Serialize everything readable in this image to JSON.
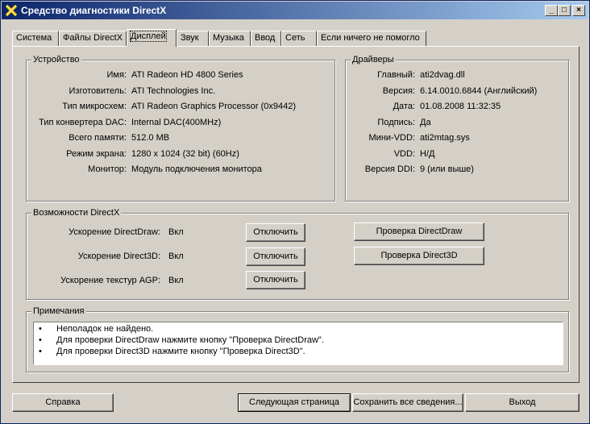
{
  "window": {
    "title": "Средство диагностики DirectX",
    "controls": {
      "minimize": "_",
      "maximize": "□",
      "close": "×"
    }
  },
  "tabs": [
    {
      "label": "Система"
    },
    {
      "label": "Файлы DirectX"
    },
    {
      "label": "Дисплей"
    },
    {
      "label": "Звук"
    },
    {
      "label": "Музыка"
    },
    {
      "label": "Ввод"
    },
    {
      "label": "Сеть"
    },
    {
      "label": "Если ничего не помогло"
    }
  ],
  "device": {
    "legend": "Устройство",
    "rows": [
      {
        "label": "Имя:",
        "value": "ATI Radeon HD 4800 Series"
      },
      {
        "label": "Изготовитель:",
        "value": "ATI Technologies Inc."
      },
      {
        "label": "Тип микросхем:",
        "value": "ATI Radeon Graphics Processor (0x9442)"
      },
      {
        "label": "Тип конвертера DAC:",
        "value": "Internal DAC(400MHz)"
      },
      {
        "label": "Всего памяти:",
        "value": "512.0 MB"
      },
      {
        "label": "Режим экрана:",
        "value": "1280 x 1024 (32 bit) (60Hz)"
      },
      {
        "label": "Монитор:",
        "value": "Модуль подключения монитора"
      }
    ]
  },
  "drivers": {
    "legend": "Драйверы",
    "rows": [
      {
        "label": "Главный:",
        "value": "ati2dvag.dll"
      },
      {
        "label": "Версия:",
        "value": "6.14.0010.6844 (Английский)"
      },
      {
        "label": "Дата:",
        "value": "01.08.2008 11:32:35"
      },
      {
        "label": "Подпись:",
        "value": "Да"
      },
      {
        "label": "Мини-VDD:",
        "value": "ati2mtag.sys"
      },
      {
        "label": "VDD:",
        "value": "Н/Д"
      },
      {
        "label": "Версия DDI:",
        "value": "9 (или выше)"
      }
    ]
  },
  "features": {
    "legend": "Возможности DirectX",
    "rows": [
      {
        "label": "Ускорение DirectDraw:",
        "value": "Вкл",
        "button": "Отключить"
      },
      {
        "label": "Ускорение Direct3D:",
        "value": "Вкл",
        "button": "Отключить"
      },
      {
        "label": "Ускорение текстур AGP:",
        "value": "Вкл",
        "button": "Отключить"
      }
    ],
    "test_directdraw": "Проверка DirectDraw",
    "test_direct3d": "Проверка Direct3D"
  },
  "notes": {
    "legend": "Примечания",
    "bullet": "•",
    "items": [
      "Неполадок не найдено.",
      "Для проверки DirectDraw нажмите кнопку \"Проверка DirectDraw\".",
      "Для проверки Direct3D нажмите кнопку \"Проверка Direct3D\"."
    ]
  },
  "footer": {
    "help": "Справка",
    "next": "Следующая страница",
    "save": "Сохранить все сведения...",
    "exit": "Выход"
  }
}
